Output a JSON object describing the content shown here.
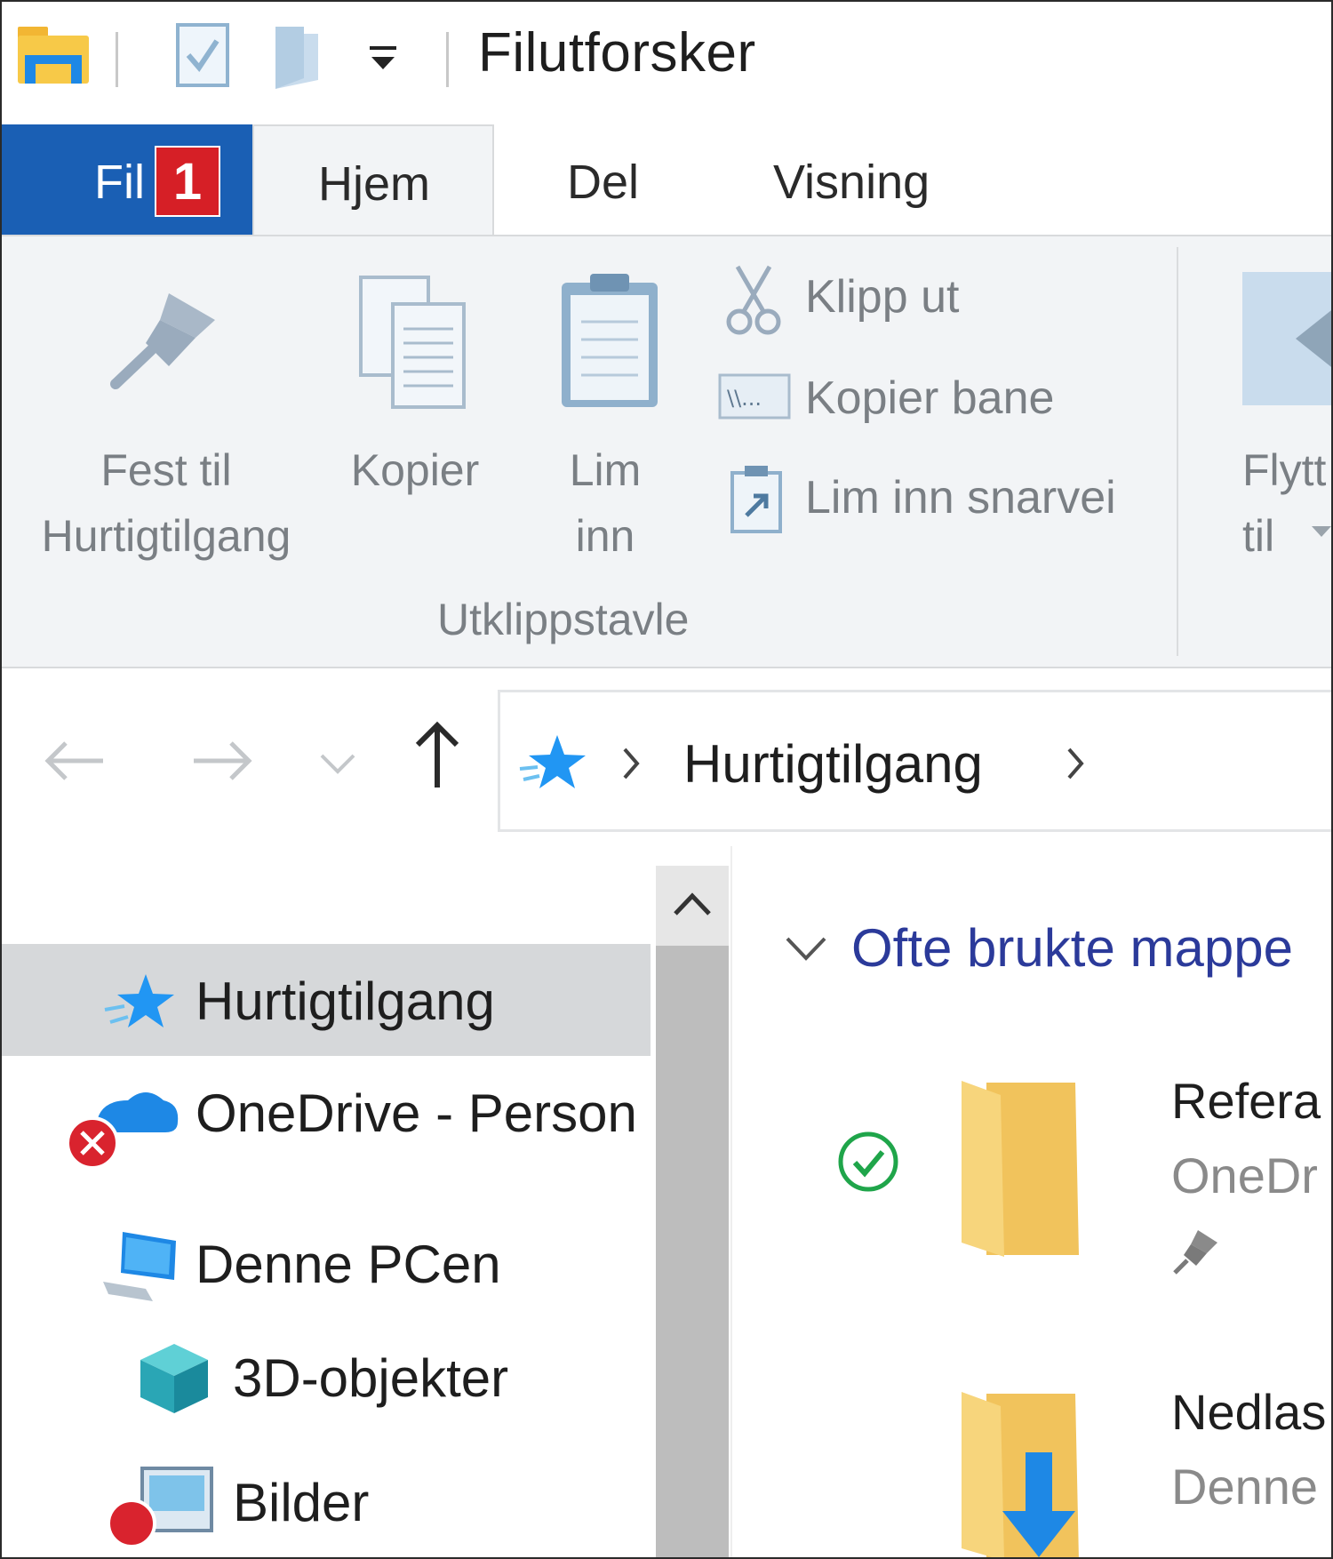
{
  "window": {
    "title": "Filutforsker"
  },
  "quick_access_toolbar": {
    "icons": [
      "explorer-app-icon",
      "properties-icon",
      "new-folder-icon",
      "customize-dropdown-icon"
    ]
  },
  "tabs": {
    "fil": {
      "label": "Fil",
      "badge": "1"
    },
    "hjem": {
      "label": "Hjem"
    },
    "del": {
      "label": "Del"
    },
    "visning": {
      "label": "Visning"
    }
  },
  "ribbon": {
    "pin": {
      "line1": "Fest til",
      "line2": "Hurtigtilgang"
    },
    "copy": {
      "label": "Kopier"
    },
    "paste": {
      "line1": "Lim",
      "line2": "inn"
    },
    "cut": {
      "label": "Klipp ut"
    },
    "copy_path": {
      "label": "Kopier bane"
    },
    "paste_shortcut": {
      "label": "Lim inn snarvei"
    },
    "group_label": "Utklippstavle",
    "move_to": {
      "line1": "Flytt",
      "line2": "til"
    }
  },
  "navigation": {
    "address": {
      "current": "Hurtigtilgang"
    }
  },
  "tree": {
    "items": [
      {
        "label": "Hurtigtilgang",
        "selected": true
      },
      {
        "label": "OneDrive - Person"
      },
      {
        "label": "Denne PCen"
      },
      {
        "label": "3D-objekter"
      },
      {
        "label": "Bilder"
      }
    ]
  },
  "content": {
    "section_title": "Ofte brukte mappe",
    "folders": [
      {
        "name": "Refera",
        "location": "OneDr"
      },
      {
        "name": "Nedlas",
        "location": "Denne"
      }
    ]
  },
  "colors": {
    "accent": "#1a5fb4",
    "badge": "#d61f26",
    "section_title": "#2b3a9a",
    "folder": "#f5cd64",
    "selection": "#d6d8da",
    "sync_ok": "#1fa54a",
    "error": "#d9232e"
  }
}
